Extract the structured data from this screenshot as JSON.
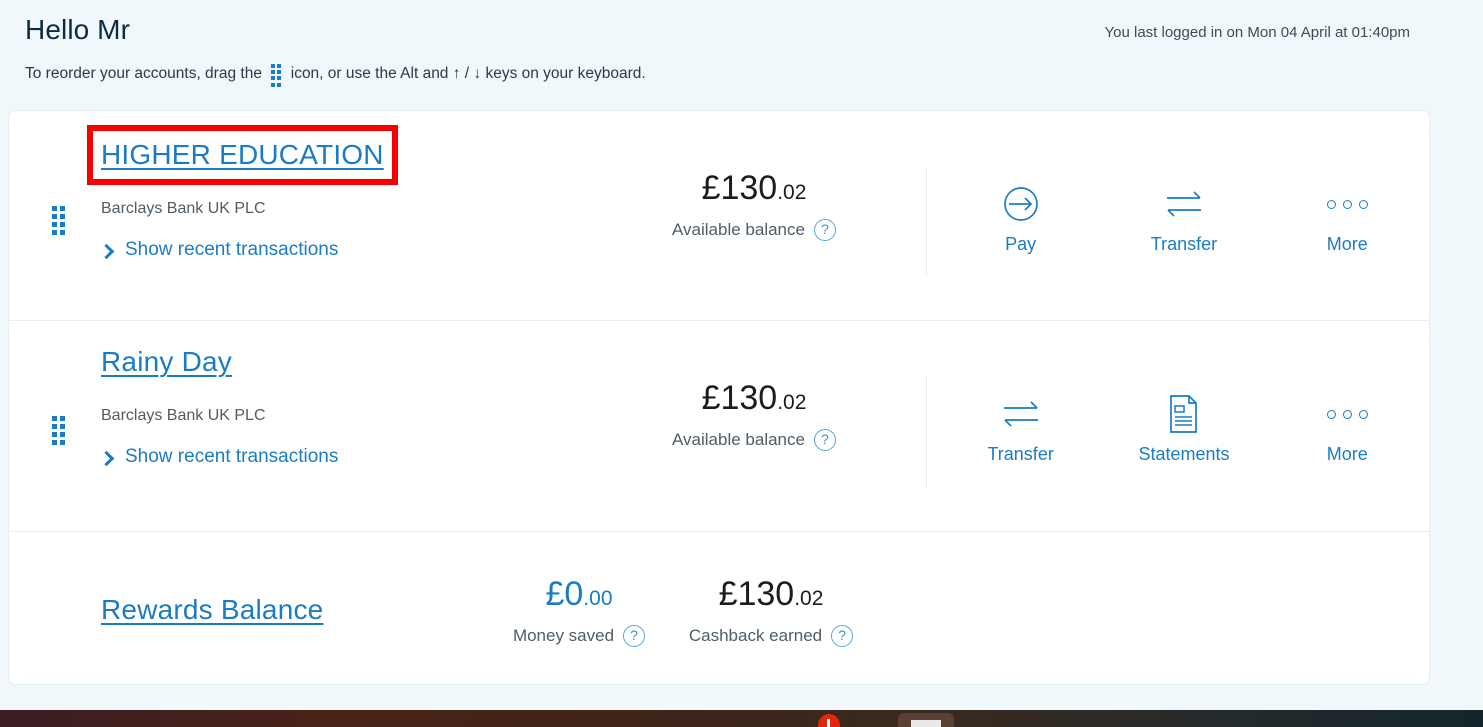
{
  "header": {
    "greeting": "Hello Mr",
    "last_login": "You last logged in on Mon 04 April at 01:40pm",
    "reorder_prefix": "To reorder your accounts, drag the ",
    "reorder_suffix": " icon, or use the Alt and ↑ / ↓ keys on your keyboard.",
    "drag_icon": "drag-handle-icon"
  },
  "colors": {
    "page_background": "#f1f8fb",
    "card_background": "#ffffff",
    "link_blue": "#1a7cc2",
    "highlight_red": "#f60000",
    "text_dark": "#1c1c1c",
    "text_muted": "#4f5d66"
  },
  "accounts": [
    {
      "name": "HIGHER EDUCATION",
      "bank": "Barclays Bank UK PLC",
      "show_transactions": "Show recent transactions",
      "amount_major": "£130",
      "amount_minor": ".02",
      "balance_label": "Available balance",
      "help_icon": "?",
      "highlighted": true,
      "actions": [
        {
          "label": "Pay",
          "icon": "pay-arrow-circle-icon"
        },
        {
          "label": "Transfer",
          "icon": "transfer-arrows-icon"
        },
        {
          "label": "More",
          "icon": "more-dots-icon"
        }
      ]
    },
    {
      "name": "Rainy Day",
      "bank": "Barclays Bank UK PLC",
      "show_transactions": "Show recent transactions",
      "amount_major": "£130",
      "amount_minor": ".02",
      "balance_label": "Available balance",
      "help_icon": "?",
      "highlighted": false,
      "actions": [
        {
          "label": "Transfer",
          "icon": "transfer-arrows-icon"
        },
        {
          "label": "Statements",
          "icon": "statement-document-icon"
        },
        {
          "label": "More",
          "icon": "more-dots-icon"
        }
      ]
    }
  ],
  "rewards": {
    "name": "Rewards Balance",
    "money_saved": {
      "amount_major": "£0",
      "amount_minor": ".00",
      "label": "Money saved",
      "help_icon": "?"
    },
    "cashback_earned": {
      "amount_major": "£130",
      "amount_minor": ".02",
      "label": "Cashback earned",
      "help_icon": "?"
    }
  }
}
